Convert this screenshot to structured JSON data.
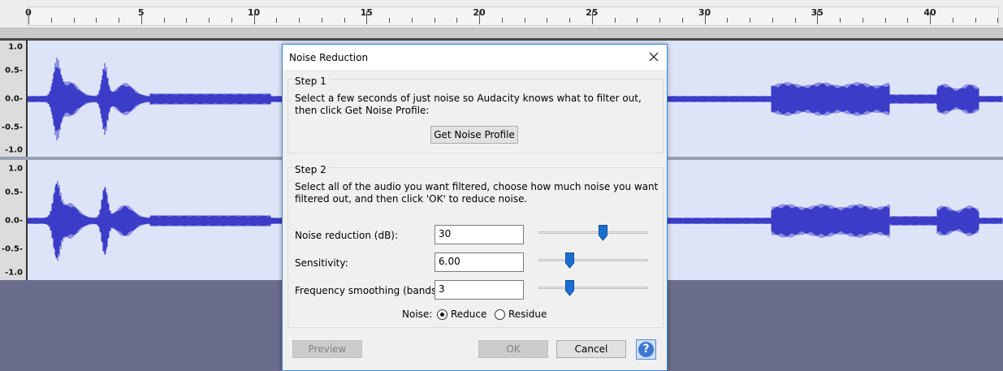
{
  "ruler": {
    "labels": [
      "0",
      "5",
      "10",
      "15",
      "20",
      "25",
      "30",
      "35",
      "40"
    ]
  },
  "tracks": {
    "scale_labels": [
      "1.0",
      "0.5-",
      "0.0-",
      "-0.5-",
      "-1.0"
    ],
    "wave_color": "#3b3cc8"
  },
  "dialog": {
    "title": "Noise Reduction",
    "step1": {
      "title": "Step 1",
      "line1": "Select a few seconds of just noise so Audacity knows what to filter out,",
      "line2": "then click Get Noise Profile:",
      "button": "Get Noise Profile"
    },
    "step2": {
      "title": "Step 2",
      "line1": "Select all of the audio you want filtered, choose how much noise you want",
      "line2": "filtered out, and then click 'OK' to reduce noise.",
      "noise_reduction": {
        "label": "Noise reduction (dB):",
        "value": "30",
        "slider_fraction": 0.6
      },
      "sensitivity": {
        "label": "Sensitivity:",
        "value": "6.00",
        "slider_fraction": 0.27
      },
      "frequency_smoothing": {
        "label": "Frequency smoothing (bands):",
        "value": "3",
        "slider_fraction": 0.27
      },
      "noise_label": "Noise:",
      "options": [
        {
          "label": "Reduce",
          "selected": true
        },
        {
          "label": "Residue",
          "selected": false
        }
      ]
    },
    "buttons": {
      "preview": "Preview",
      "ok": "OK",
      "cancel": "Cancel",
      "help": "?"
    }
  },
  "colors": {
    "accent": "#3c8dd8",
    "slider_thumb": "#1a6fd1",
    "track_bg": "#dde4f7",
    "background": "#6a6d8c"
  },
  "icons": [
    "close-icon",
    "help-icon"
  ]
}
